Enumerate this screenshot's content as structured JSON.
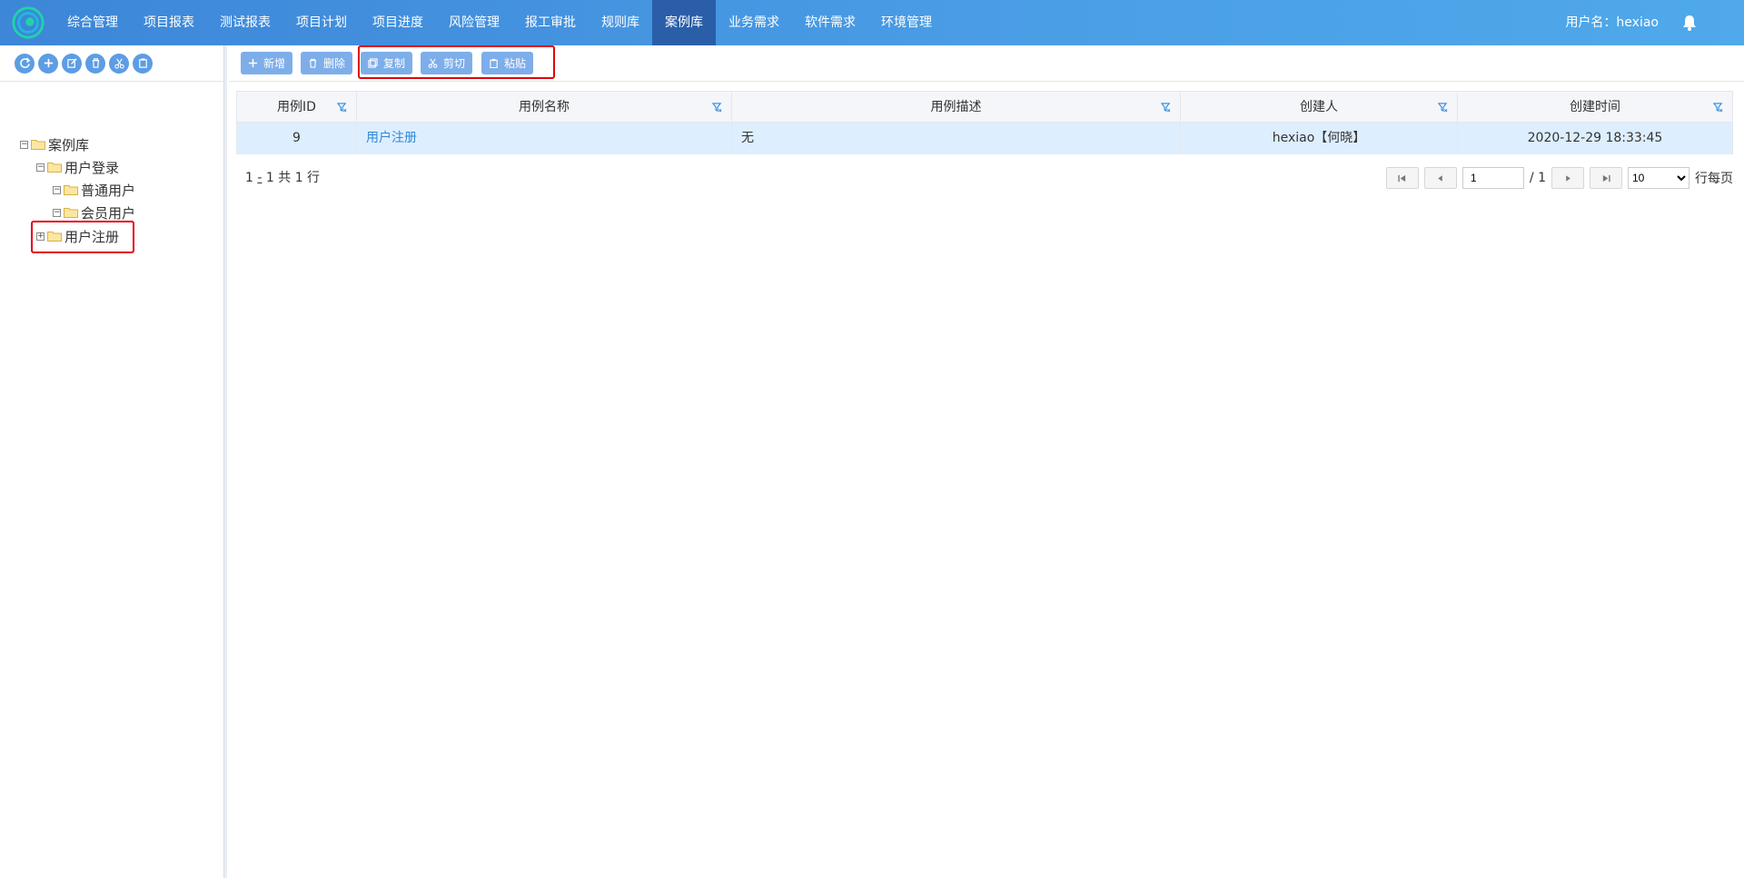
{
  "nav": {
    "items": [
      "综合管理",
      "项目报表",
      "测试报表",
      "项目计划",
      "项目进度",
      "风险管理",
      "报工审批",
      "规则库",
      "案例库",
      "业务需求",
      "软件需求",
      "环境管理"
    ],
    "active_index": 8,
    "user_label": "用户名：hexiao"
  },
  "tree": {
    "root": "案例库",
    "user_login": "用户登录",
    "normal_user": "普通用户",
    "member_user": "会员用户",
    "user_register": "用户注册"
  },
  "toolbar": {
    "add": "新增",
    "delete": "删除",
    "copy": "复制",
    "cut": "剪切",
    "paste": "粘贴"
  },
  "grid": {
    "headers": [
      "用例ID",
      "用例名称",
      "用例描述",
      "创建人",
      "创建时间"
    ],
    "rows": [
      {
        "id": "9",
        "name": "用户注册",
        "desc": "无",
        "creator": "hexiao【何晓】",
        "created": "2020-12-29 18:33:45"
      }
    ]
  },
  "pager": {
    "summary_a": "1",
    "summary_b": "-",
    "summary_c": "1 共 1 行",
    "page": "1",
    "total": "/ 1",
    "per_page": "10",
    "per_page_label": "行每页"
  },
  "colors": {
    "accent": "#4a9ee6",
    "active_nav": "#2a5ea8",
    "button": "#7eaee9",
    "highlight": "#e3000f"
  }
}
